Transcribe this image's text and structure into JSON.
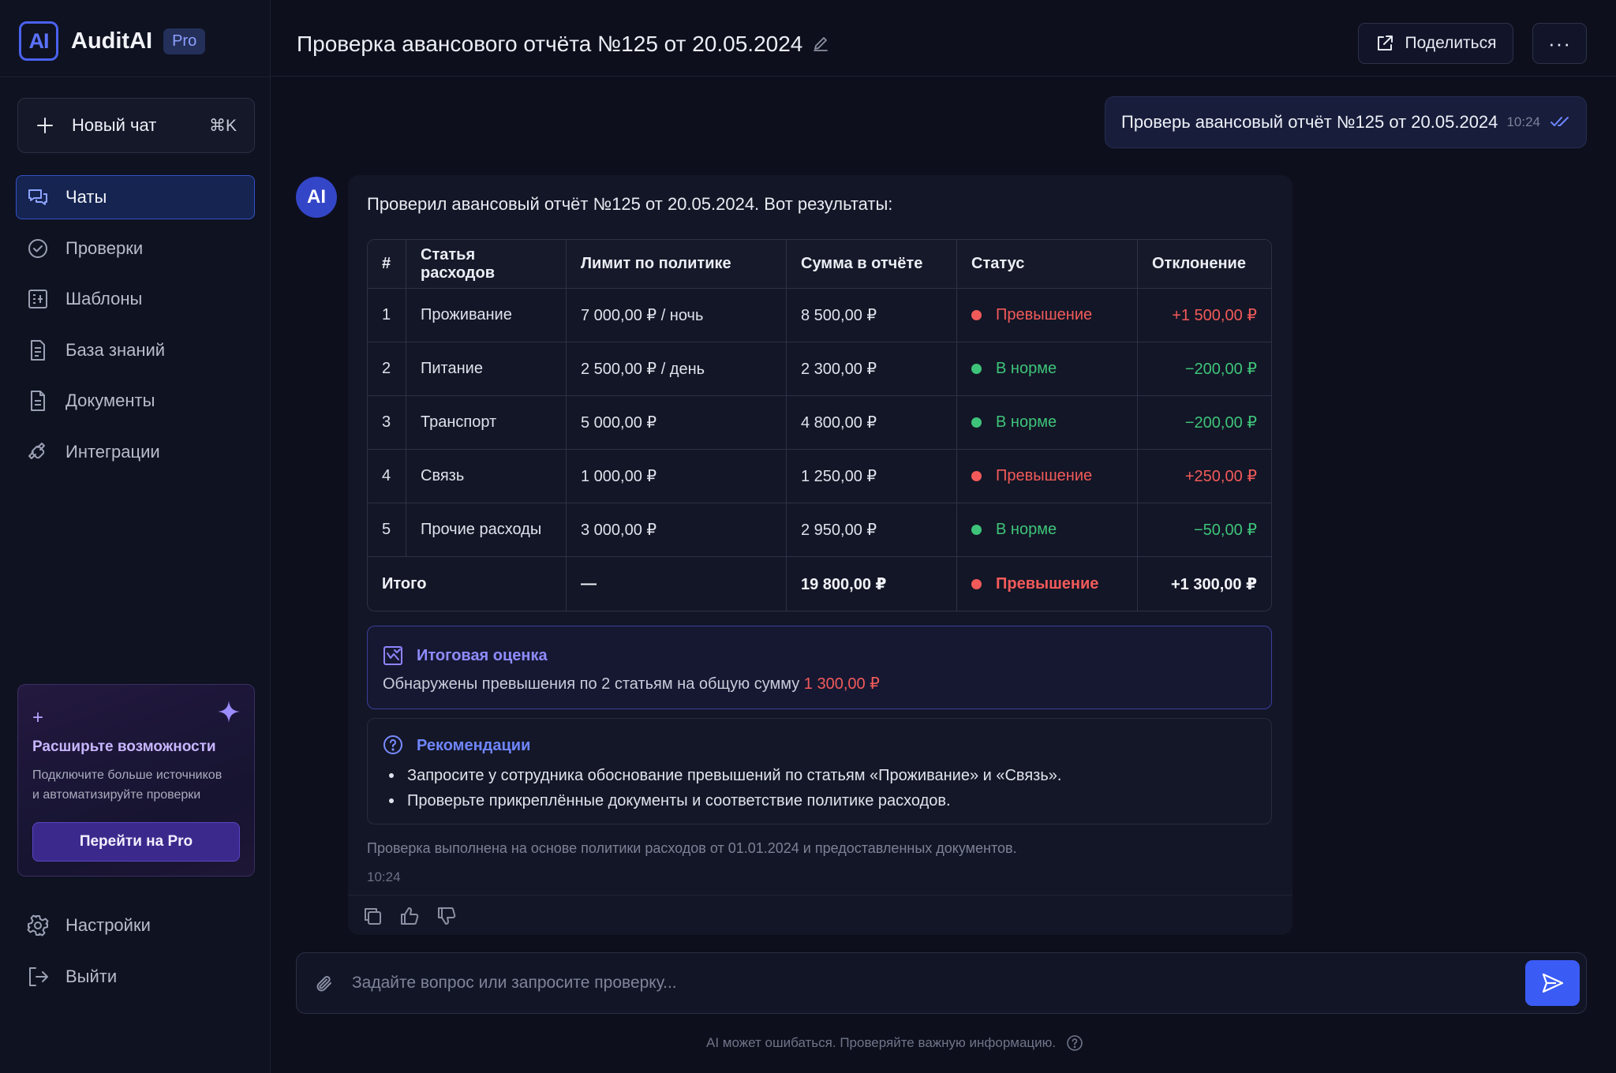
{
  "app": {
    "logo_text": "AI",
    "name": "AuditAI",
    "badge": "Pro"
  },
  "sidebar": {
    "new_chat": {
      "label": "Новый чат",
      "shortcut": "⌘K"
    },
    "items": [
      {
        "label": "Чаты",
        "icon": "chat-icon",
        "active": true
      },
      {
        "label": "Проверки",
        "icon": "check-circle-icon"
      },
      {
        "label": "Шаблоны",
        "icon": "template-icon"
      },
      {
        "label": "База знаний",
        "icon": "knowledge-base-icon"
      },
      {
        "label": "Документы",
        "icon": "document-icon"
      },
      {
        "label": "Интеграции",
        "icon": "integrations-icon"
      }
    ],
    "promo": {
      "title": "Расширьте возможности",
      "text_line1": "Подключите больше источников",
      "text_line2": "и автоматизируйте проверки",
      "button": "Перейти на Pro"
    },
    "bottom_items": [
      {
        "label": "Настройки",
        "icon": "settings-icon"
      },
      {
        "label": "Выйти",
        "icon": "logout-icon"
      }
    ]
  },
  "header": {
    "title": "Проверка авансового отчёта №125 от 20.05.2024",
    "share_label": "Поделиться",
    "more_label": "···"
  },
  "conversation": {
    "user_message": {
      "text": "Проверь авансовый отчёт №125 от 20.05.2024",
      "time": "10:24"
    },
    "ai_message": {
      "avatar": "AI",
      "intro": "Проверил авансовый отчёт №125 от 20.05.2024. Вот результаты:",
      "table": {
        "columns": [
          "#",
          "Статья расходов",
          "Лимит по политике",
          "Сумма в отчёте",
          "Статус",
          "Отклонение"
        ],
        "rows": [
          {
            "n": "1",
            "item": "Проживание",
            "limit": "7 000,00 ₽ / ночь",
            "amount": "8 500,00 ₽",
            "status": "Превышение",
            "status_type": "over",
            "deviation": "+1 500,00 ₽"
          },
          {
            "n": "2",
            "item": "Питание",
            "limit": "2 500,00 ₽ / день",
            "amount": "2 300,00 ₽",
            "status": "В норме",
            "status_type": "ok",
            "deviation": "−200,00 ₽"
          },
          {
            "n": "3",
            "item": "Транспорт",
            "limit": "5 000,00 ₽",
            "amount": "4 800,00 ₽",
            "status": "В норме",
            "status_type": "ok",
            "deviation": "−200,00 ₽"
          },
          {
            "n": "4",
            "item": "Связь",
            "limit": "1 000,00 ₽",
            "amount": "1 250,00 ₽",
            "status": "Превышение",
            "status_type": "over",
            "deviation": "+250,00 ₽"
          },
          {
            "n": "5",
            "item": "Прочие расходы",
            "limit": "3 000,00 ₽",
            "amount": "2 950,00 ₽",
            "status": "В норме",
            "status_type": "ok",
            "deviation": "−50,00 ₽"
          }
        ],
        "total": {
          "label": "Итого",
          "limit": "—",
          "amount": "19 800,00 ₽",
          "status": "Превышение",
          "status_type": "over",
          "deviation": "+1 300,00 ₽"
        }
      },
      "summary": {
        "title": "Итоговая оценка",
        "text": "Обнаружены превышения по 2 статьям на общую сумму",
        "amount": "1 300,00 ₽"
      },
      "recommendations": {
        "title": "Рекомендации",
        "items": [
          "Запросите у сотрудника обоснование превышений по статьям «Проживание» и «Связь».",
          "Проверьте прикреплённые документы и соответствие политике расходов."
        ]
      },
      "footnote": "Проверка выполнена на основе политики расходов от 01.01.2024 и предоставленных документов.",
      "time": "10:24"
    }
  },
  "composer": {
    "placeholder": "Задайте вопрос или запросите проверку...",
    "disclaimer": "AI может ошибаться. Проверяйте важную информацию."
  },
  "colors": {
    "accent": "#3b5bf5",
    "over": "#f25a5a",
    "ok": "#3ec47a",
    "background": "#0d0f1c"
  }
}
